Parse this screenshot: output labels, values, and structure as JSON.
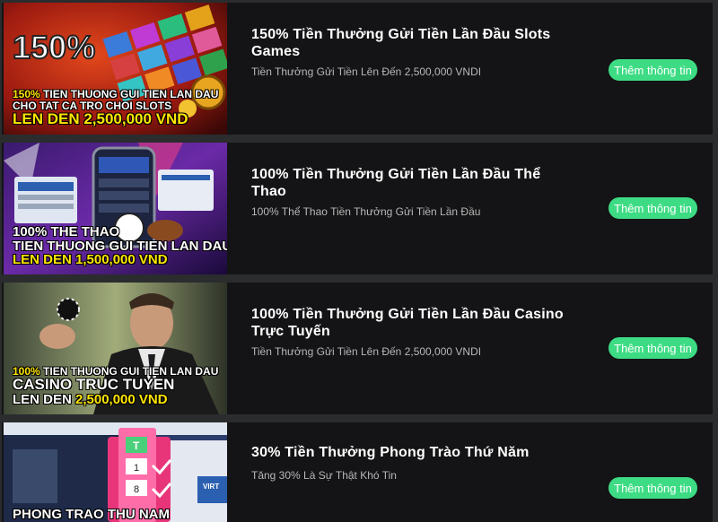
{
  "promotions": [
    {
      "title": "150% Tiền Thưởng Gửi Tiền Lần Đầu Slots Games",
      "subtitle": "Tiền Thưởng Gửi Tiền Lên Đến 2,500,000 VNDI",
      "button": "Thêm thông tin",
      "banner": {
        "big": "150%",
        "line1_accent": "150%",
        "line1": " TIEN THUONG GUI TIEN LAN DAU",
        "line2": "CHO TAT CA TRO CHOI SLOTS",
        "line3": "LEN DEN 2,500,000 VND"
      }
    },
    {
      "title": "100% Tiền Thưởng Gửi Tiền Lần Đầu Thể Thao",
      "subtitle": "100% Thể Thao Tiền Thưởng Gửi Tiền Lần Đầu",
      "button": "Thêm thông tin",
      "banner": {
        "line1": "100% THE THAO",
        "line2": "TIEN THUONG GUI TIEN LAN DAU",
        "line3": "LEN DEN 1,500,000 VND"
      }
    },
    {
      "title": "100% Tiền Thưởng Gửi Tiền Lần Đầu Casino Trực Tuyến",
      "subtitle": "Tiền Thưởng Gửi Tiền Lên Đến 2,500,000 VNDI",
      "button": "Thêm thông tin",
      "banner": {
        "line1_accent": "100%",
        "line1": " TIEN THUONG GUI TIEN LAN DAU",
        "line2": "CASINO TRUC TUYEN",
        "line3_a": "LEN DEN ",
        "line3_b": "2,500,000 VND"
      }
    },
    {
      "title": "30% Tiền Thưởng Phong Trào Thứ Năm",
      "subtitle": "Tăng 30% Là Sự Thật Khó Tin",
      "button": "Thêm thông tin",
      "banner": {
        "line1": "PHONG TRAO THU NAM",
        "tile_t": "T",
        "tile_1": "1",
        "tile_8": "8",
        "side": "VIRT"
      }
    }
  ]
}
